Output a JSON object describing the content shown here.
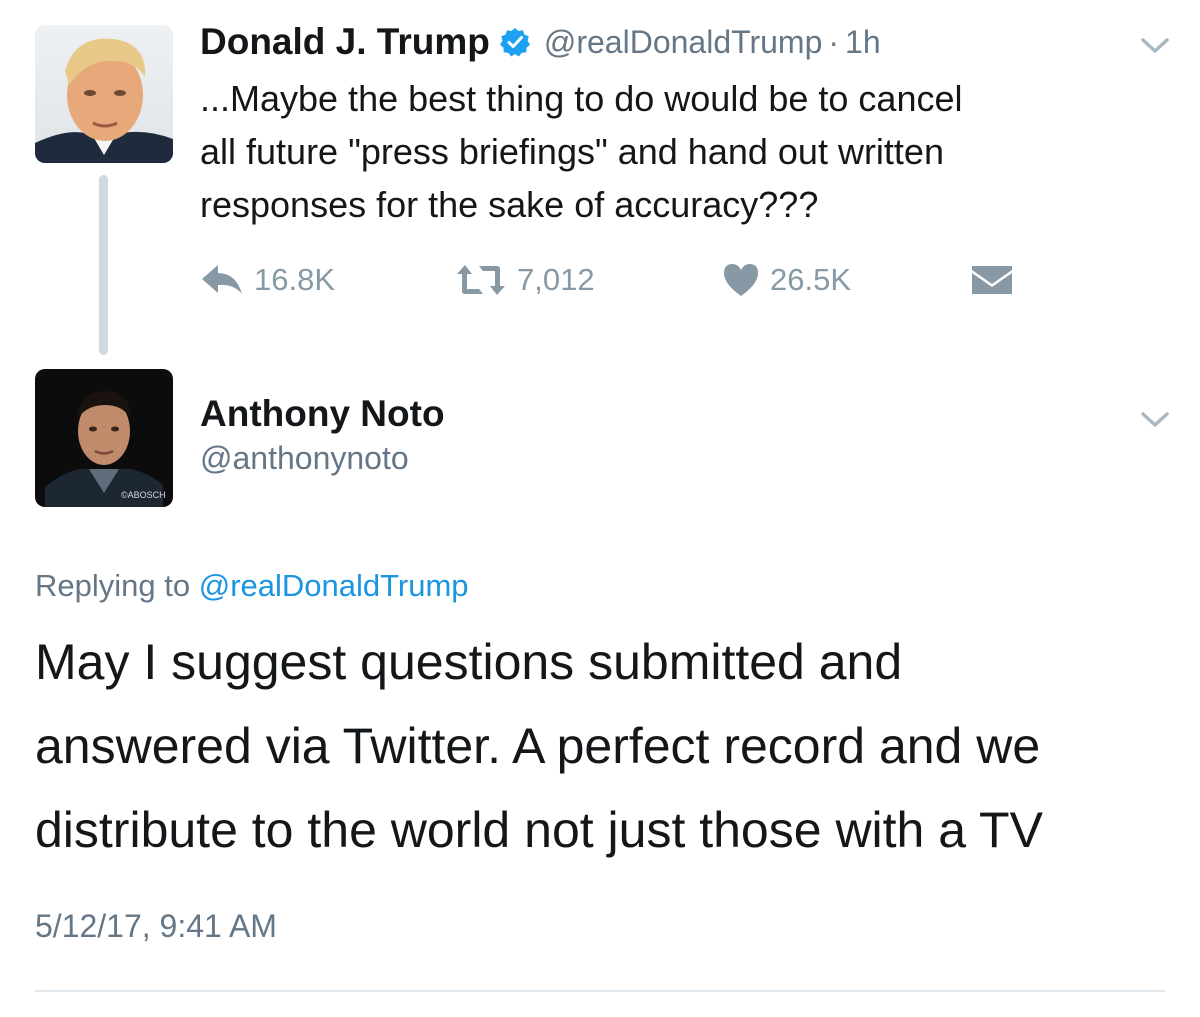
{
  "tweet": {
    "author_name": "Donald J. Trump",
    "handle": "@realDonaldTrump",
    "separator": "·",
    "time_ago": "1h",
    "text_lines": [
      "...Maybe the best thing to do would be to cancel",
      "all future \"press briefings\" and hand out written",
      "responses for the sake of accuracy???"
    ],
    "actions": {
      "reply_count": "16.8K",
      "retweet_count": "7,012",
      "like_count": "26.5K"
    },
    "icons": {
      "verified": "verified-badge-icon",
      "reply": "reply-icon",
      "retweet": "retweet-icon",
      "like": "heart-icon",
      "dm": "direct-message-icon",
      "menu": "chevron-down-icon"
    }
  },
  "reply": {
    "author_name": "Anthony Noto",
    "handle": "@anthonynoto",
    "avatar_watermark": "©ABOSCH",
    "replying_prefix": "Replying to",
    "replying_to": "@realDonaldTrump",
    "text_lines": [
      "May I suggest questions submitted and",
      "answered via Twitter. A perfect record and we",
      "distribute to the world not just those with a TV"
    ],
    "timestamp": "5/12/17, 9:41 AM"
  },
  "colors": {
    "text": "#14171a",
    "secondary": "#657786",
    "icon_gray": "#8899a6",
    "link_blue": "#1b95e0",
    "verified_blue": "#1da1f2",
    "thread_line": "#cfd9de",
    "divider": "#e1e8ed"
  }
}
